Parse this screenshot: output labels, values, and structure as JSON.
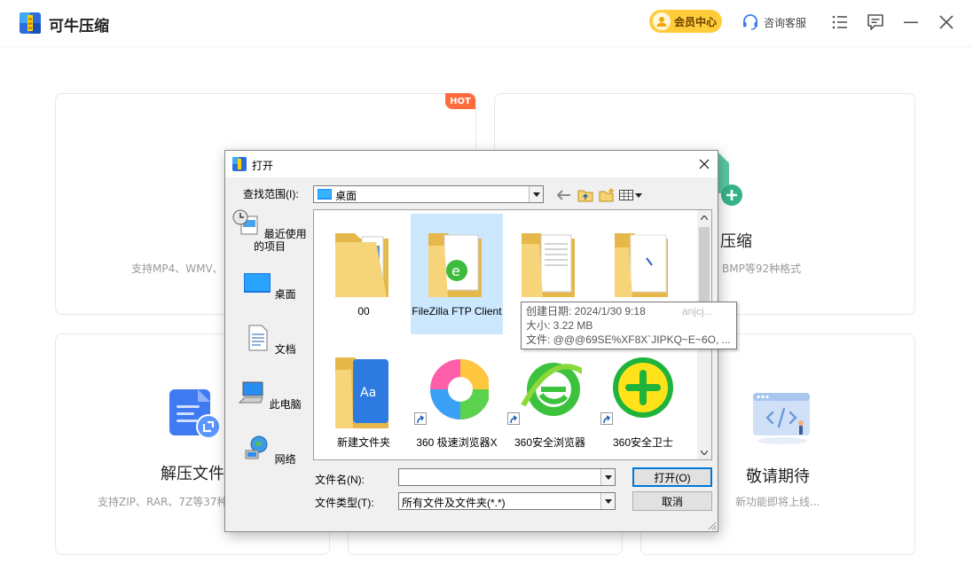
{
  "app": {
    "title": "可牛压缩",
    "vip_label": "会员中心",
    "service_label": "咨询客服"
  },
  "cards": {
    "video": {
      "badge": "HOT",
      "desc": "支持MP4、WMV、"
    },
    "image": {
      "title": "压缩",
      "desc": "BMP等92种格式"
    },
    "extract": {
      "title": "解压文件",
      "desc": "支持ZIP、RAR、7Z等37种"
    },
    "soon": {
      "title": "敬请期待",
      "desc": "新功能即将上线..."
    }
  },
  "dialog": {
    "title": "打开",
    "look_in_label": "查找范围(I):",
    "look_in_value": "桌面",
    "places": [
      "最近使用的项目",
      "桌面",
      "文档",
      "此电脑",
      "网络"
    ],
    "files": [
      {
        "name": "00",
        "type": "folder"
      },
      {
        "name": "FileZilla FTP Client",
        "type": "folder-app",
        "selected": true
      },
      {
        "name": "",
        "type": "folder-docs"
      },
      {
        "name": "",
        "type": "folder-pen"
      },
      {
        "name": "新建文件夹",
        "type": "folder-translate"
      },
      {
        "name": "360 极速浏览器X",
        "type": "shortcut-360x"
      },
      {
        "name": "360安全浏览器",
        "type": "shortcut-360se"
      },
      {
        "name": "360安全卫士",
        "type": "shortcut-360safe"
      }
    ],
    "tooltip": {
      "created": "创建日期: 2024/1/30 9:18",
      "size": "大小: 3.22 MB",
      "files": "文件: @@@69SE%XF8X`JIPKQ~E~6O, ...",
      "partial_name": "anjcj..."
    },
    "filename_label": "文件名(N):",
    "filename_value": "",
    "filetype_label": "文件类型(T):",
    "filetype_value": "所有文件及文件夹(*.*)",
    "open_button": "打开(O)",
    "cancel_button": "取消"
  },
  "colors": {
    "accent_blue": "#0078d7",
    "vip_gold": "#ffcc3a",
    "hot_orange": "#ff6b3d",
    "selection": "#cce8ff"
  }
}
